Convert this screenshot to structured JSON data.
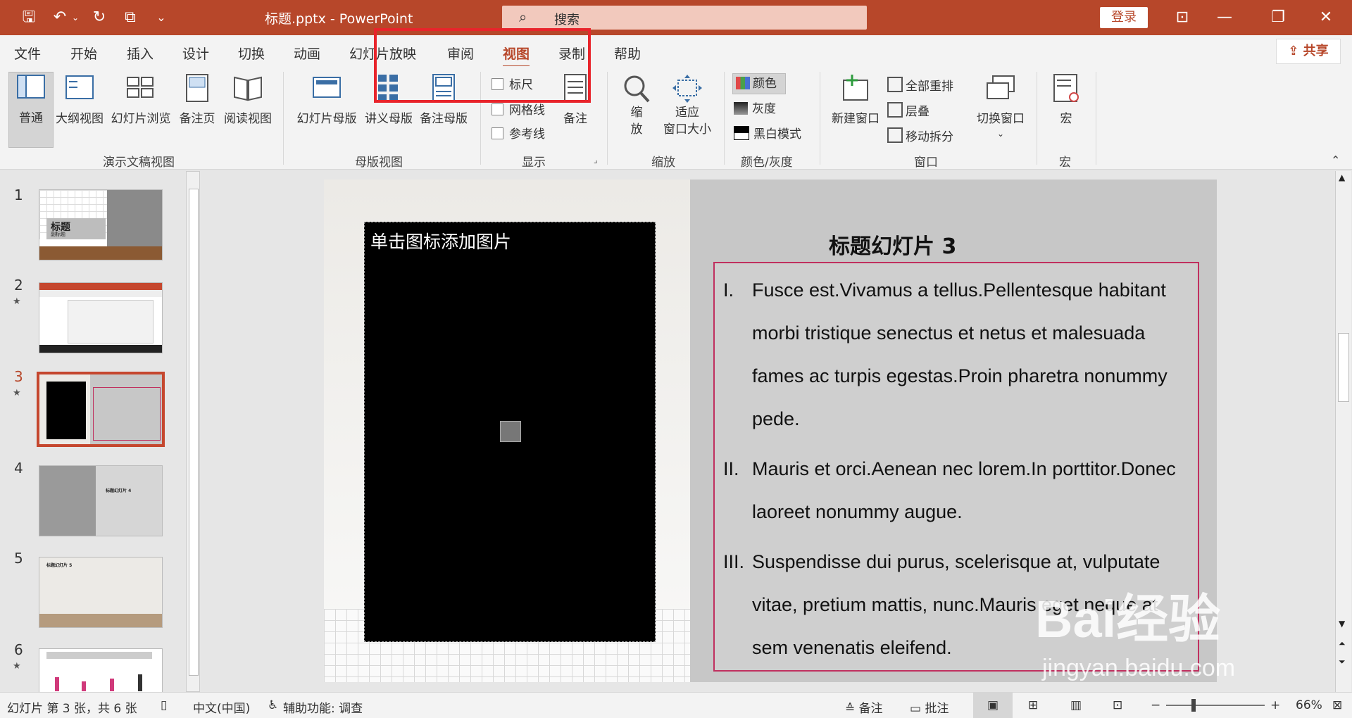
{
  "window": {
    "doc_title": "标题.pptx - PowerPoint",
    "search_placeholder": "搜索",
    "login": "登录"
  },
  "tabs": [
    "文件",
    "开始",
    "插入",
    "设计",
    "切换",
    "动画",
    "幻灯片放映",
    "审阅",
    "视图",
    "录制",
    "帮助"
  ],
  "active_tab": "视图",
  "share": "共享",
  "ribbon": {
    "presentation_views": {
      "label": "演示文稿视图",
      "items": [
        "普通",
        "大纲视图",
        "幻灯片浏览",
        "备注页",
        "阅读视图"
      ]
    },
    "master_views": {
      "label": "母版视图",
      "items": [
        "幻灯片母版",
        "讲义母版",
        "备注母版"
      ]
    },
    "show": {
      "label": "显示",
      "items": [
        "标尺",
        "网格线",
        "参考线"
      ],
      "notes": "备注"
    },
    "zoom": {
      "label": "缩放",
      "zoom_btn_line1": "缩",
      "zoom_btn_line2": "放",
      "fit_line1": "适应",
      "fit_line2": "窗口大小"
    },
    "color": {
      "label": "颜色/灰度",
      "items": [
        "颜色",
        "灰度",
        "黑白模式"
      ]
    },
    "window": {
      "label": "窗口",
      "new_window": "新建窗口",
      "items": [
        "全部重排",
        "层叠",
        "移动拆分"
      ],
      "switch": "切换窗口"
    },
    "macros": {
      "label": "宏",
      "item": "宏"
    }
  },
  "thumbnails": [
    {
      "num": "1",
      "title": "标题",
      "sub": "副标题"
    },
    {
      "num": "2",
      "star": "★"
    },
    {
      "num": "3",
      "star": "★"
    },
    {
      "num": "4",
      "title": "标题幻灯片 4"
    },
    {
      "num": "5",
      "title": "标题幻灯片 5"
    },
    {
      "num": "6",
      "star": "★"
    }
  ],
  "selected_slide": 3,
  "slide": {
    "pic_placeholder": "单击图标添加图片",
    "title": "标题幻灯片 3",
    "bullets": [
      {
        "num": "I.",
        "text": "Fusce est.Vivamus a tellus.Pellentesque habitant morbi tristique senectus et netus et malesuada fames ac turpis egestas.Proin pharetra nonummy pede."
      },
      {
        "num": "II.",
        "text": "Mauris et orci.Aenean nec lorem.In porttitor.Donec laoreet nonummy augue."
      },
      {
        "num": "III.",
        "text": "Suspendisse dui purus, scelerisque at, vulputate vitae, pretium mattis, nunc.Mauris eget neque at sem venenatis eleifend."
      }
    ]
  },
  "status": {
    "slide_info": "幻灯片 第 3 张，共 6 张",
    "language": "中文(中国)",
    "accessibility": "辅助功能: 调查",
    "notes": "备注",
    "comments": "批注",
    "zoom": "66%"
  },
  "watermark": {
    "line1": "Bai经验",
    "line2": "jingyan.baidu.com"
  }
}
